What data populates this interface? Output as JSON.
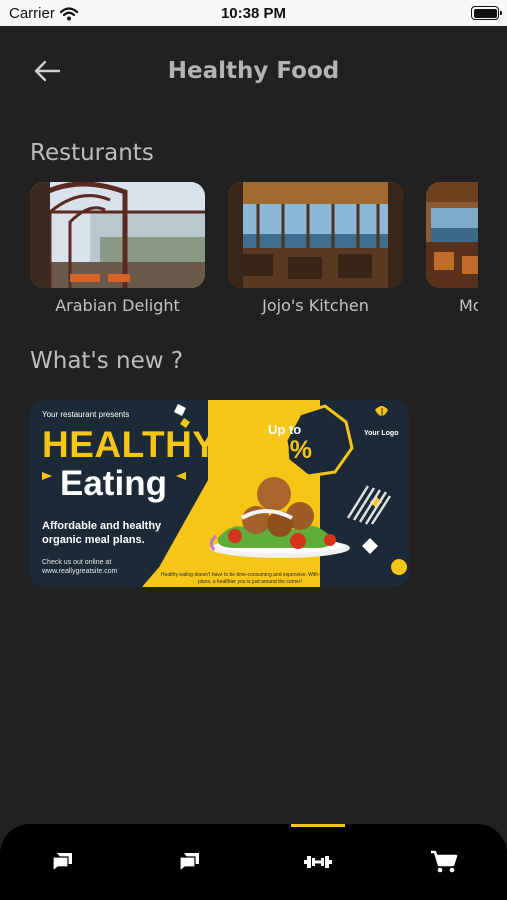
{
  "status_bar": {
    "carrier": "Carrier",
    "time": "10:38 PM"
  },
  "header": {
    "title": "Healthy Food",
    "back_icon": "arrow-left-icon"
  },
  "restaurants": {
    "section_title": "Resturants",
    "items": [
      {
        "name": "Arabian Delight"
      },
      {
        "name": "Jojo's Kitchen"
      },
      {
        "name": "Mo"
      }
    ]
  },
  "whats_new": {
    "section_title": "What's new ?",
    "banner": {
      "presents": "Your restaurant presents",
      "headline_1": "HEALTHY",
      "headline_2": "Eating",
      "tagline": "Affordable and healthy organic meal plans.",
      "check": "Check us out online at www.reallygreatsite.com",
      "badge_top": "Up to",
      "badge_value": "50%",
      "logo_text": "Your Logo",
      "fine_print": "Healthy eating doesn't have to be time-consuming and expensive. With our meal plans, a healthier you is just around the corner!"
    }
  },
  "tab_bar": {
    "tabs": [
      {
        "icon": "chat-bubble-icon",
        "active": false
      },
      {
        "icon": "chat-bubble-icon",
        "active": false
      },
      {
        "icon": "dumbbell-icon",
        "active": true
      },
      {
        "icon": "cart-icon",
        "active": false
      }
    ]
  },
  "colors": {
    "background": "#212121",
    "accent": "#f5c518",
    "tab_bar": "#000000",
    "banner_navy": "#1c2a38"
  }
}
